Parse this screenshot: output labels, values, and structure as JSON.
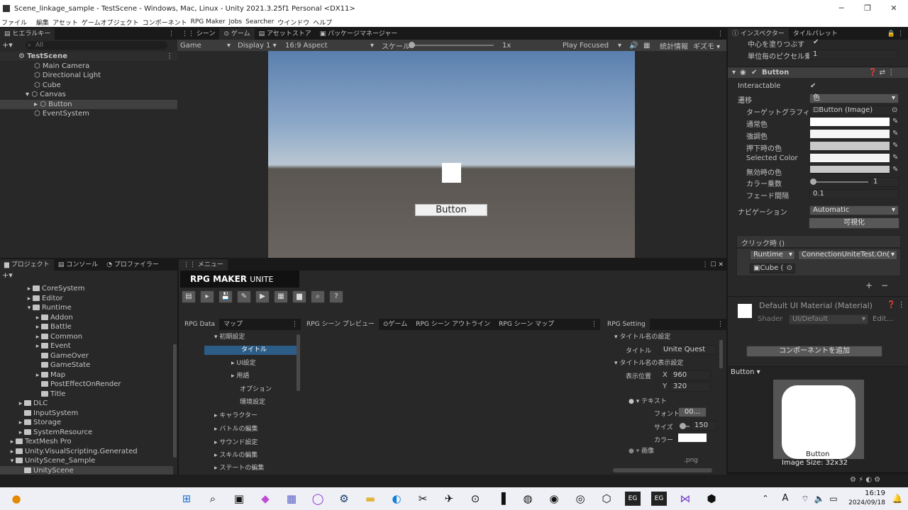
{
  "window": {
    "title": "Scene_linkage_sample - TestScene - Windows, Mac, Linux - Unity 2021.3.25f1 Personal <DX11>"
  },
  "menu": [
    "ファイル",
    "編集",
    "アセット",
    "ゲームオブジェクト",
    "コンポーネント",
    "RPG Maker",
    "Jobs",
    "Searcher",
    "ウインドウ",
    "ヘルプ"
  ],
  "hierarchy": {
    "tab": "ヒエラルキー",
    "search_placeholder": "All",
    "scene": "TestScene",
    "items": [
      "Main Camera",
      "Directional Light",
      "Cube",
      "Canvas",
      "Button",
      "EventSystem"
    ]
  },
  "scene_tabs": [
    "シーン",
    "ゲーム",
    "アセットストア",
    "パッケージマネージャー"
  ],
  "game_toolbar": {
    "mode": "Game",
    "display": "Display 1",
    "aspect": "16:9 Aspect",
    "scale_label": "スケール",
    "scale_value": "1x",
    "play": "Play Focused",
    "stats": "統計情報",
    "gizmos": "ギズモ"
  },
  "game_view": {
    "button_label": "Button"
  },
  "project": {
    "tabs": [
      "プロジェクト",
      "コンソール",
      "プロファイラー"
    ],
    "items": [
      "CoreSystem",
      "Editor",
      "Runtime",
      "Addon",
      "Battle",
      "Common",
      "Event",
      "GameOver",
      "GameState",
      "Map",
      "PostEffectOnRender",
      "Title",
      "DLC",
      "InputSystem",
      "Storage",
      "SystemResource",
      "TextMesh Pro",
      "Unity.VisualScripting.Generated",
      "UnityScene_Sample",
      "UnityScene"
    ]
  },
  "rpg": {
    "menu_tab": "メニュー",
    "logo": "RPG MAKER",
    "logo2": "UNITE",
    "left_tabs": [
      "RPG Data",
      "マップ"
    ],
    "tree": [
      "初期設定",
      "タイトル",
      "UI設定",
      "用語",
      "オプション",
      "環境設定",
      "キャラクター",
      "バトルの編集",
      "サウンド設定",
      "スキルの編集",
      "ステートの編集"
    ],
    "center_tabs": [
      "RPG シーン プレビュー",
      "ゲーム",
      "RPG シーン アウトライン",
      "RPG シーン マップ"
    ],
    "setting": {
      "tab": "RPG Setting",
      "sec1": "タイトル名の設定",
      "title_label": "タイトル",
      "title_value": "Unite Quest",
      "sec2": "タイトル名の表示設定",
      "pos_label": "表示位置",
      "x_label": "X",
      "x": "960",
      "y_label": "Y",
      "y": "320",
      "text_label": "テキスト",
      "font_label": "フォント",
      "font_value": "00...",
      "size_label": "サイズ",
      "size_value": "150",
      "color_label": "カラー",
      "image_label": "画像",
      "png": ".png"
    }
  },
  "inspector": {
    "tabs": [
      "インスペクター",
      "タイルパレット"
    ],
    "top1": "中心を塗りつぶす",
    "top2": "単位毎のピクセル乗数",
    "top2_value": "1",
    "component": "Button",
    "interactable": "Interactable",
    "transition": "遷移",
    "transition_value": "色",
    "target_graphic": "ターゲットグラフィックス",
    "target_value": "Button (Image)",
    "normal": "通常色",
    "highlighted": "強調色",
    "pressed": "押下時の色",
    "selected": "Selected Color",
    "disabled": "無効時の色",
    "multiplier": "カラー乗数",
    "multiplier_value": "1",
    "fade": "フェード間隔",
    "fade_value": "0.1",
    "navigation": "ナビゲーション",
    "navigation_value": "Automatic",
    "visualize": "可視化",
    "onclick": "クリック時 ()",
    "runtime": "Runtime",
    "function": "ConnectionUniteTest.On(",
    "target_obj": "Cube (",
    "material": "Default UI Material (Material)",
    "shader_label": "Shader",
    "shader_value": "UI/Default",
    "edit": "Edit...",
    "add_component": "コンポーネントを追加",
    "preview_label": "Button",
    "preview_title": "Button",
    "image_size": "Image Size: 32x32"
  },
  "taskbar": {
    "time": "16:19",
    "date": "2024/09/18",
    "ime": "A"
  }
}
